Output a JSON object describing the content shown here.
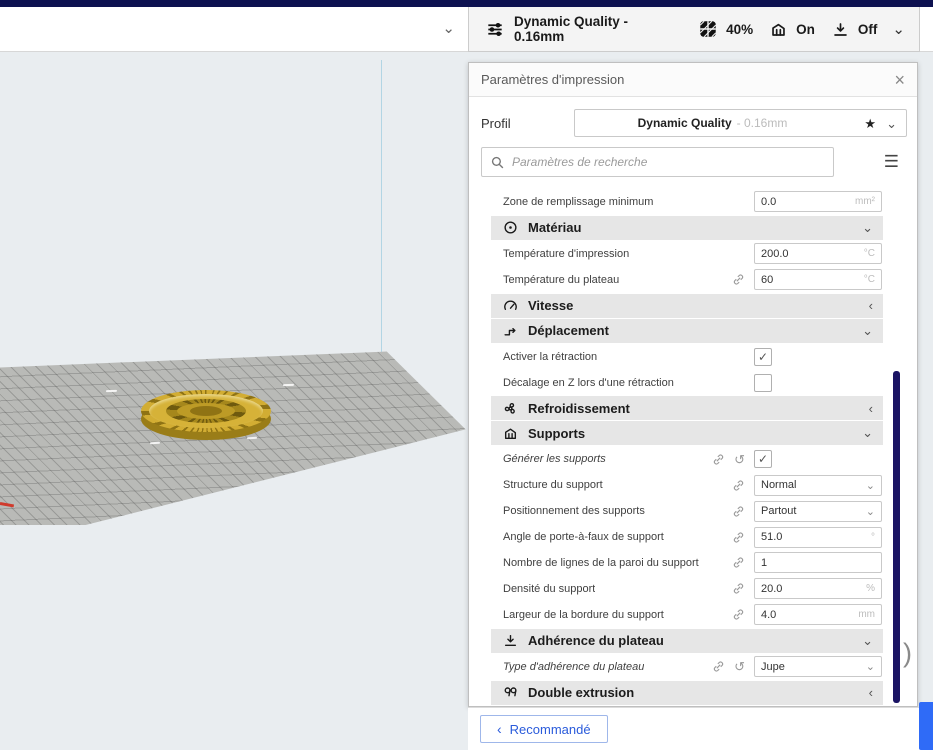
{
  "topbar": {
    "collapse_chevron": "⌄",
    "summary": {
      "profile": "Dynamic Quality - 0.16mm",
      "infill": "40%",
      "support": "On",
      "adhesion": "Off",
      "chevron": "⌄"
    }
  },
  "panel": {
    "title": "Paramètres d'impression",
    "close": "×",
    "profile": {
      "label": "Profil",
      "name": "Dynamic Quality",
      "detail": "- 0.16mm",
      "star": "★",
      "chevron": "⌄"
    },
    "search": {
      "placeholder": "Paramètres de recherche",
      "menu": "☰"
    },
    "rows": [
      {
        "type": "number",
        "label": "Zone de remplissage minimum",
        "value": "0.0",
        "unit": "mm²"
      },
      {
        "type": "section",
        "label": "Matériau",
        "chevron": "⌄"
      },
      {
        "type": "number",
        "label": "Température d'impression",
        "value": "200.0",
        "unit": "°C"
      },
      {
        "type": "number",
        "label": "Température du plateau",
        "value": "60",
        "unit": "°C"
      },
      {
        "type": "section",
        "label": "Vitesse",
        "chevron": "‹"
      },
      {
        "type": "section",
        "label": "Déplacement",
        "chevron": "⌄"
      },
      {
        "type": "checkbox",
        "label": "Activer la rétraction",
        "check": "✓"
      },
      {
        "type": "checkbox",
        "label": "Décalage en Z lors d'une rétraction",
        "check": ""
      },
      {
        "type": "section",
        "label": "Refroidissement",
        "chevron": "‹"
      },
      {
        "type": "section",
        "label": "Supports",
        "chevron": "⌄"
      },
      {
        "type": "checkbox",
        "label": "Générer les supports",
        "check": "✓",
        "revert": "↺"
      },
      {
        "type": "dropdown",
        "label": "Structure du support",
        "value": "Normal",
        "chevron": "⌄"
      },
      {
        "type": "dropdown",
        "label": "Positionnement des supports",
        "value": "Partout",
        "chevron": "⌄"
      },
      {
        "type": "number",
        "label": "Angle de porte-à-faux de support",
        "value": "51.0",
        "unit": "°"
      },
      {
        "type": "number",
        "label": "Nombre de lignes de la paroi du support",
        "value": "1",
        "unit": ""
      },
      {
        "type": "number",
        "label": "Densité du support",
        "value": "20.0",
        "unit": "%"
      },
      {
        "type": "number",
        "label": "Largeur de la bordure du support",
        "value": "4.0",
        "unit": "mm"
      },
      {
        "type": "section",
        "label": "Adhérence du plateau",
        "chevron": "⌄"
      },
      {
        "type": "dropdown",
        "label": "Type d'adhérence du plateau",
        "value": "Jupe",
        "chevron": "⌄",
        "revert": "↺"
      },
      {
        "type": "section",
        "label": "Double extrusion",
        "chevron": "‹"
      }
    ],
    "footer": {
      "chevron": "‹",
      "label": "Recommandé"
    }
  },
  "misc": {
    "partial_glyph": ")"
  }
}
